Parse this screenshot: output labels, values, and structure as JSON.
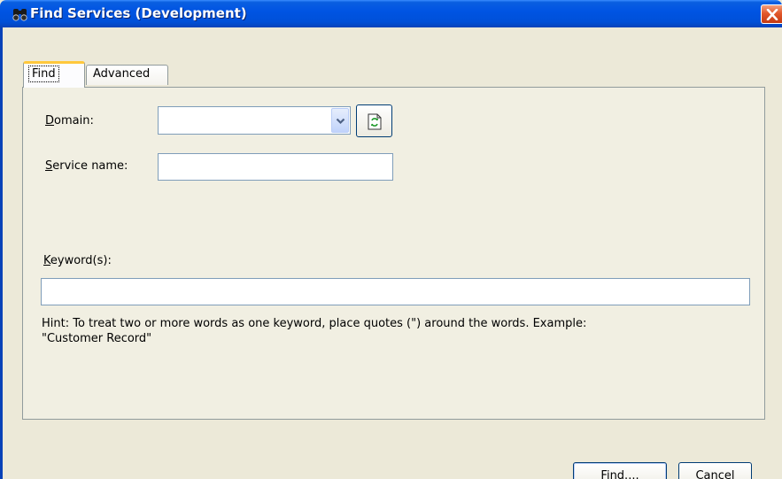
{
  "window": {
    "title": "Find Services (Development)",
    "accent_color": "#0054e3",
    "close_color": "#e2582b"
  },
  "tabs": [
    {
      "label": "Find",
      "active": true
    },
    {
      "label": "Advanced",
      "active": false
    }
  ],
  "form": {
    "domain": {
      "label_key": "D",
      "label_rest": "omain:",
      "value": ""
    },
    "service_name": {
      "label_key": "S",
      "label_rest": "ervice name:",
      "value": ""
    },
    "keywords": {
      "label_key": "K",
      "label_rest": "eyword(s):",
      "value": ""
    },
    "hint_line1": "Hint: To treat two or more words as one keyword, place quotes (\") around the words. Example:",
    "hint_line2": "\"Customer Record\""
  },
  "buttons": {
    "find": {
      "key": "F",
      "rest": "ind...."
    },
    "cancel": {
      "key": "C",
      "rest": "ancel"
    }
  },
  "icons": {
    "title": "binoculars-icon",
    "close": "close-icon",
    "dropdown": "chevron-down-icon",
    "refresh": "refresh-icon"
  }
}
